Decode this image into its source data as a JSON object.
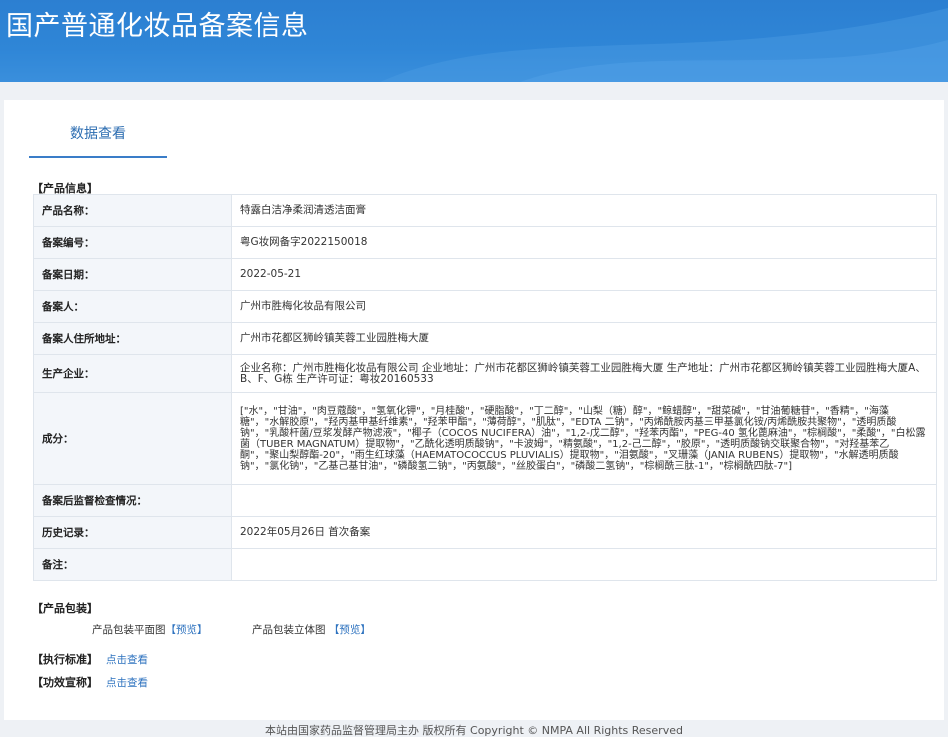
{
  "header": {
    "title": "国产普通化妆品备案信息"
  },
  "tab": {
    "label": "数据查看"
  },
  "product_info": {
    "section_title": "【产品信息】",
    "rows": [
      {
        "label": "产品名称：",
        "value": "特露白洁净柔润清透洁面膏"
      },
      {
        "label": "备案编号：",
        "value": "粤G妆网备字2022150018"
      },
      {
        "label": "备案日期：",
        "value": "2022-05-21"
      },
      {
        "label": "备案人：",
        "value": "广州市胜梅化妆品有限公司"
      },
      {
        "label": "备案人住所地址：",
        "value": "广州市花都区狮岭镇芙蓉工业园胜梅大厦"
      },
      {
        "label": "生产企业：",
        "value": "企业名称：广州市胜梅化妆品有限公司 企业地址：广州市花都区狮岭镇芙蓉工业园胜梅大厦 生产地址：广州市花都区狮岭镇芙蓉工业园胜梅大厦A、B、F、G栋 生产许可证：粤妆20160533"
      },
      {
        "label": "成分：",
        "value": "[\"水\"，\"甘油\"，\"肉豆蔻酸\"，\"氢氧化钾\"，\"月桂酸\"，\"硬脂酸\"，\"丁二醇\"，\"山梨（糖）醇\"，\"鲸蜡醇\"，\"甜菜碱\"，\"甘油葡糖苷\"，\"香精\"，\"海藻糖\"，\"水解胶原\"，\"羟丙基甲基纤维素\"，\"羟苯甲酯\"，\"薄荷醇\"，\"肌肽\"，\"EDTA 二钠\"，\"丙烯酰胺丙基三甲基氯化铵/丙烯酰胺共聚物\"，\"透明质酸钠\"，\"乳酸杆菌/豆浆发酵产物滤液\"，\"椰子（COCOS NUCIFERA）油\"，\"1,2-戊二醇\"，\"羟苯丙酯\"，\"PEG-40 氢化蓖麻油\"，\"棕榈酸\"，\"柔酸\"，\"白松露菌（TUBER MAGNATUM）提取物\"，\"乙酰化透明质酸钠\"，\"卡波姆\"，\"精氨酸\"，\"1,2-己二醇\"，\"胶原\"，\"透明质酸钠交联聚合物\"，\"对羟基苯乙酮\"，\"聚山梨醇酯-20\"，\"雨生红球藻（HAEMATOCOCCUS PLUVIALIS）提取物\"，\"泪氨酸\"，\"叉珊藻（JANIA RUBENS）提取物\"，\"水解透明质酸钠\"，\"氯化钠\"，\"乙基己基甘油\"，\"磷酸氢二钠\"，\"丙氨酸\"，\"丝胶蛋白\"，\"磷酸二氢钠\"，\"棕榈酰三肽-1\"，\"棕榈酰四肽-7\"]"
      },
      {
        "label": "备案后监督检查情况：",
        "value": ""
      },
      {
        "label": "历史记录：",
        "value": "2022年05月26日 首次备案"
      },
      {
        "label": "备注：",
        "value": ""
      }
    ]
  },
  "packaging": {
    "section_title": "【产品包装】",
    "flat_label": "产品包装平面图",
    "flat_link": "【预览】",
    "solid_label": "产品包装立体图",
    "solid_link": "【预览】"
  },
  "standard": {
    "section_title": "【执行标准】",
    "link": "点击查看"
  },
  "efficacy": {
    "section_title": "【功效宣称】",
    "link": "点击查看"
  },
  "footer": {
    "text": "本站由国家药品监督管理局主办 版权所有 Copyright © NMPA All Rights Reserved"
  },
  "colors": {
    "header_blue": "#2f86d7",
    "link_blue": "#2d72bf",
    "label_bg": "#f3f6fa"
  }
}
